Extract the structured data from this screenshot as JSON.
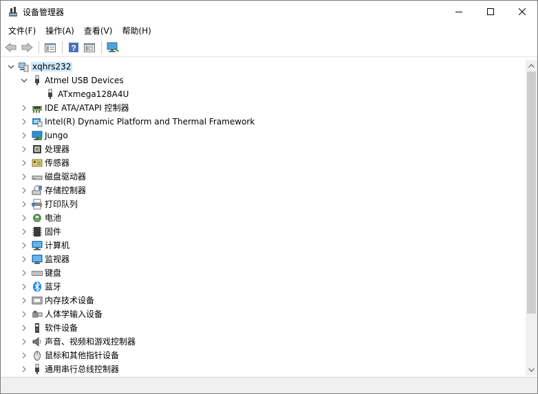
{
  "window": {
    "title": "设备管理器"
  },
  "menu": [
    "文件(F)",
    "操作(A)",
    "查看(V)",
    "帮助(H)"
  ],
  "toolbar": [
    "back-icon",
    "forward-icon",
    "properties-icon",
    "help-icon",
    "show-hidden-icon",
    "scan-hardware-icon"
  ],
  "tree": {
    "root": "xqhrs232",
    "items": [
      {
        "label": "Atmel USB Devices",
        "icon": "usb-icon",
        "expanded": true,
        "children": [
          {
            "label": "ATxmega128A4U",
            "icon": "usb-icon"
          }
        ]
      },
      {
        "label": "IDE ATA/ATAPI 控制器",
        "icon": "ide-controller-icon"
      },
      {
        "label": "Intel(R) Dynamic Platform and Thermal Framework",
        "icon": "platform-icon"
      },
      {
        "label": "Jungo",
        "icon": "monitor-network-icon"
      },
      {
        "label": "处理器",
        "icon": "cpu-icon"
      },
      {
        "label": "传感器",
        "icon": "sensor-icon"
      },
      {
        "label": "磁盘驱动器",
        "icon": "disk-drive-icon"
      },
      {
        "label": "存储控制器",
        "icon": "storage-controller-icon"
      },
      {
        "label": "打印队列",
        "icon": "printer-icon"
      },
      {
        "label": "电池",
        "icon": "battery-icon"
      },
      {
        "label": "固件",
        "icon": "firmware-icon"
      },
      {
        "label": "计算机",
        "icon": "computer-icon"
      },
      {
        "label": "监视器",
        "icon": "monitor-icon"
      },
      {
        "label": "键盘",
        "icon": "keyboard-icon"
      },
      {
        "label": "蓝牙",
        "icon": "bluetooth-icon"
      },
      {
        "label": "内存技术设备",
        "icon": "memory-device-icon"
      },
      {
        "label": "人体学输入设备",
        "icon": "hid-icon"
      },
      {
        "label": "软件设备",
        "icon": "software-device-icon"
      },
      {
        "label": "声音、视频和游戏控制器",
        "icon": "sound-icon"
      },
      {
        "label": "鼠标和其他指针设备",
        "icon": "mouse-icon"
      },
      {
        "label": "通用串行总线控制器",
        "icon": "usb-icon"
      }
    ]
  }
}
